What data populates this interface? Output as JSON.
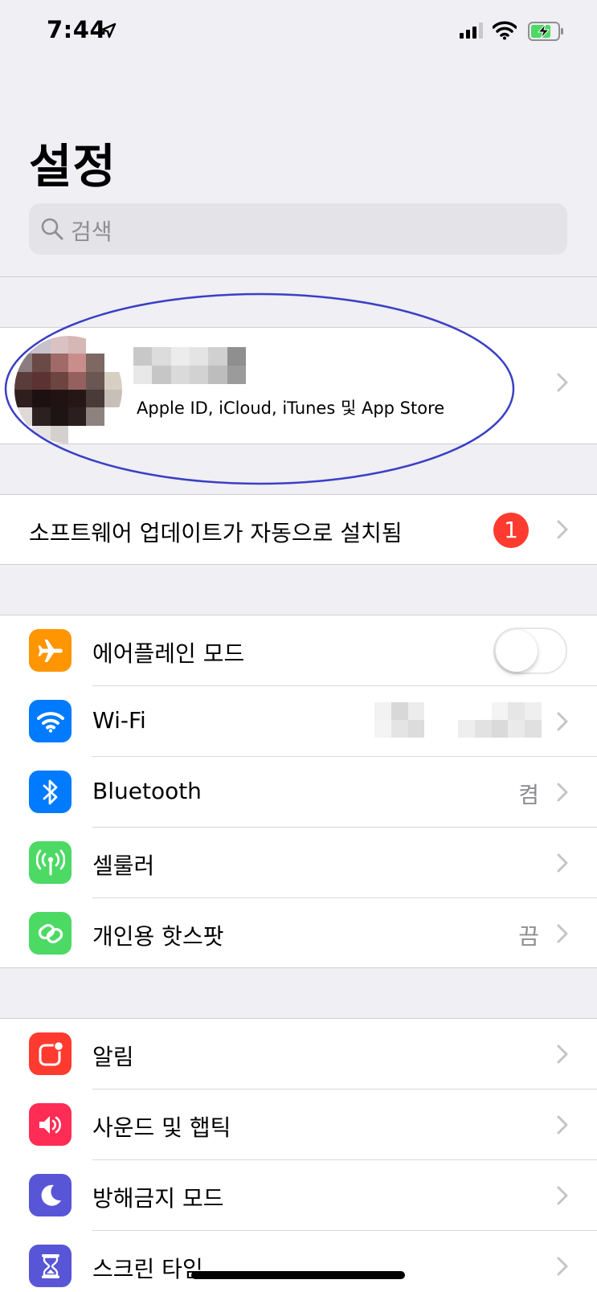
{
  "status_bar": {
    "time": "7:44"
  },
  "header": {
    "title": "설정"
  },
  "search": {
    "placeholder": "검색"
  },
  "profile": {
    "subtitle": "Apple ID, iCloud, iTunes 및 App Store"
  },
  "update": {
    "label": "소프트웨어 업데이트가 자동으로 설치됨",
    "badge": "1"
  },
  "connectivity": {
    "airplane": {
      "label": "에어플레인 모드",
      "icon": "airplane-icon",
      "color": "#ff9500",
      "toggle_on": false
    },
    "wifi": {
      "label": "Wi-Fi",
      "icon": "wifi-icon",
      "color": "#007aff"
    },
    "bluetooth": {
      "label": "Bluetooth",
      "detail": "켬",
      "icon": "bluetooth-icon",
      "color": "#007aff"
    },
    "cellular": {
      "label": "셀룰러",
      "icon": "cellular-antenna-icon",
      "color": "#4cd964"
    },
    "hotspot": {
      "label": "개인용 핫스팟",
      "detail": "끔",
      "icon": "hotspot-icon",
      "color": "#4cd964"
    }
  },
  "notifications_group": {
    "notifications": {
      "label": "알림",
      "icon": "notifications-icon",
      "color": "#ff3b30"
    },
    "sounds": {
      "label": "사운드 및 햅틱",
      "icon": "speaker-icon",
      "color": "#ff2d55"
    },
    "dnd": {
      "label": "방해금지 모드",
      "icon": "moon-icon",
      "color": "#5856d6"
    },
    "screen_time": {
      "label": "스크린 타임",
      "icon": "hourglass-icon",
      "color": "#5856d6"
    }
  }
}
